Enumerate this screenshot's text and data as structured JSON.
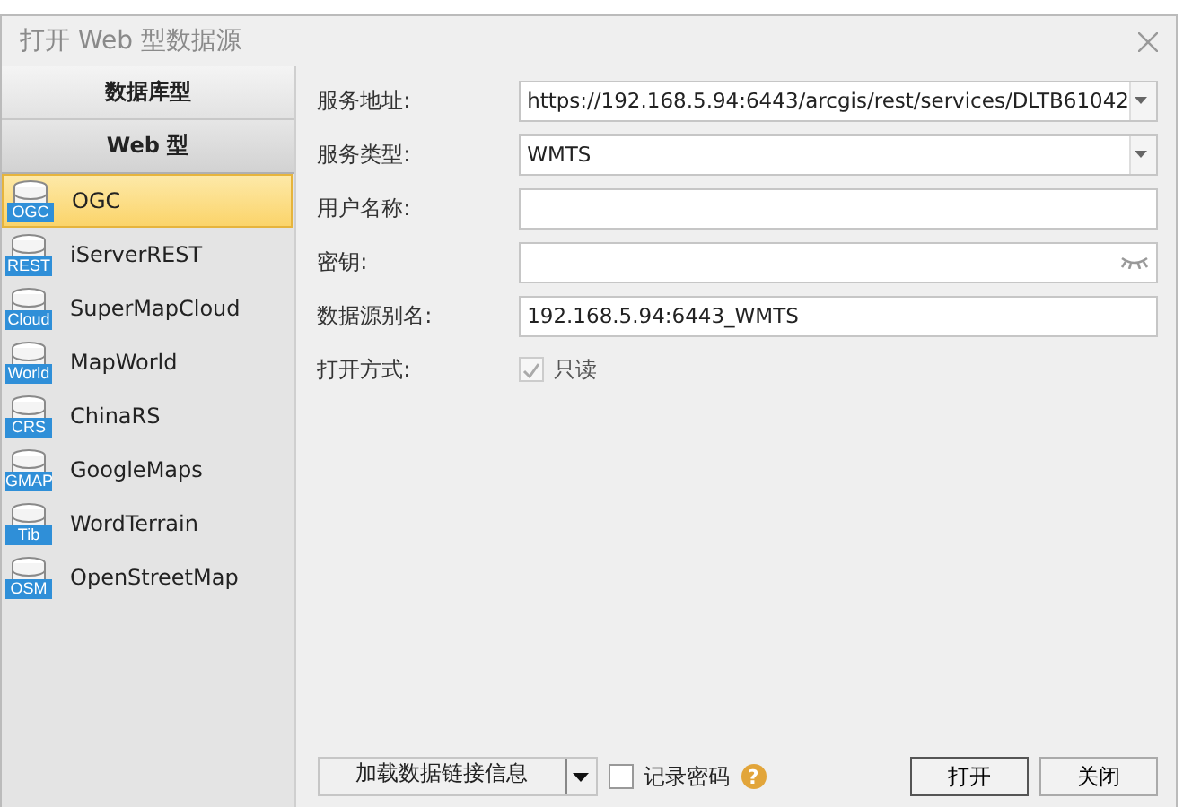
{
  "window": {
    "title": "打开 Web 型数据源"
  },
  "sidebar": {
    "tabs": [
      {
        "label": "数据库型",
        "selected": false
      },
      {
        "label": "Web 型",
        "selected": true
      }
    ],
    "items": [
      {
        "label": "OGC",
        "icon_text": "OGC",
        "selected": true
      },
      {
        "label": "iServerREST",
        "icon_text": "REST",
        "selected": false
      },
      {
        "label": "SuperMapCloud",
        "icon_text": "Cloud",
        "selected": false
      },
      {
        "label": "MapWorld",
        "icon_text": "World",
        "selected": false
      },
      {
        "label": "ChinaRS",
        "icon_text": "CRS",
        "selected": false
      },
      {
        "label": "GoogleMaps",
        "icon_text": "GMAP",
        "selected": false
      },
      {
        "label": "WordTerrain",
        "icon_text": "Tib",
        "selected": false
      },
      {
        "label": "OpenStreetMap",
        "icon_text": "OSM",
        "selected": false
      }
    ]
  },
  "form": {
    "fields": [
      {
        "label": "服务地址:",
        "kind": "dropdown",
        "value": "https://192.168.5.94:6443/arcgis/rest/services/DLTB61042"
      },
      {
        "label": "服务类型:",
        "kind": "dropdown",
        "value": "WMTS"
      },
      {
        "label": "用户名称:",
        "kind": "text"
      },
      {
        "label": "密钥:",
        "kind": "password"
      },
      {
        "label": "数据源别名:",
        "kind": "text",
        "value": "192.168.5.94:6443_WMTS"
      },
      {
        "label": "打开方式:",
        "kind": "checkbox",
        "option": "只读",
        "checked": true,
        "disabled": true
      }
    ]
  },
  "footer": {
    "split_button": "加载数据链接信息",
    "remember": {
      "label": "记录密码",
      "checked": false
    },
    "help_icon": "?",
    "buttons": [
      "打开",
      "关闭"
    ]
  }
}
